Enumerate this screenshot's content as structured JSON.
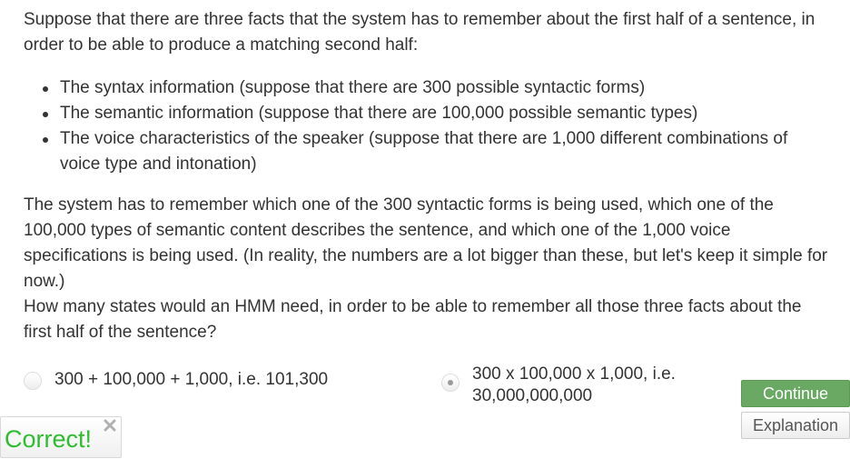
{
  "question": {
    "intro": "Suppose that there are three facts that the system has to remember about the first half of a sentence, in order to be able to produce a matching second half:",
    "facts": [
      "The syntax information (suppose that there are 300 possible syntactic forms)",
      "The semantic information (suppose that there are 100,000 possible semantic types)",
      "The voice characteristics of the speaker (suppose that there are 1,000 different combinations of voice type and intonation)"
    ],
    "explanation": "The system has to remember which one of the 300 syntactic forms is being used, which one of the 100,000 types of semantic content describes the sentence, and which one of the 1,000 voice specifications is being used. (In reality, the numbers are a lot bigger than these, but let's keep it simple for now.)",
    "prompt": "How many states would an HMM need, in order to be able to remember all those three facts about the first half of the sentence?"
  },
  "options": [
    {
      "label": "300 + 100,000 + 1,000, i.e. 101,300",
      "selected": false
    },
    {
      "label": "300 x 100,000 x 1,000, i.e. 30,000,000,000",
      "selected": true
    }
  ],
  "buttons": {
    "continue_label": "Continue",
    "explanation_label": "Explanation"
  },
  "feedback": {
    "text": "Correct!",
    "close_icon": "close-icon",
    "color": "#2fbd2f"
  },
  "colors": {
    "continue_bg": "#6aa964",
    "text": "#333333"
  }
}
